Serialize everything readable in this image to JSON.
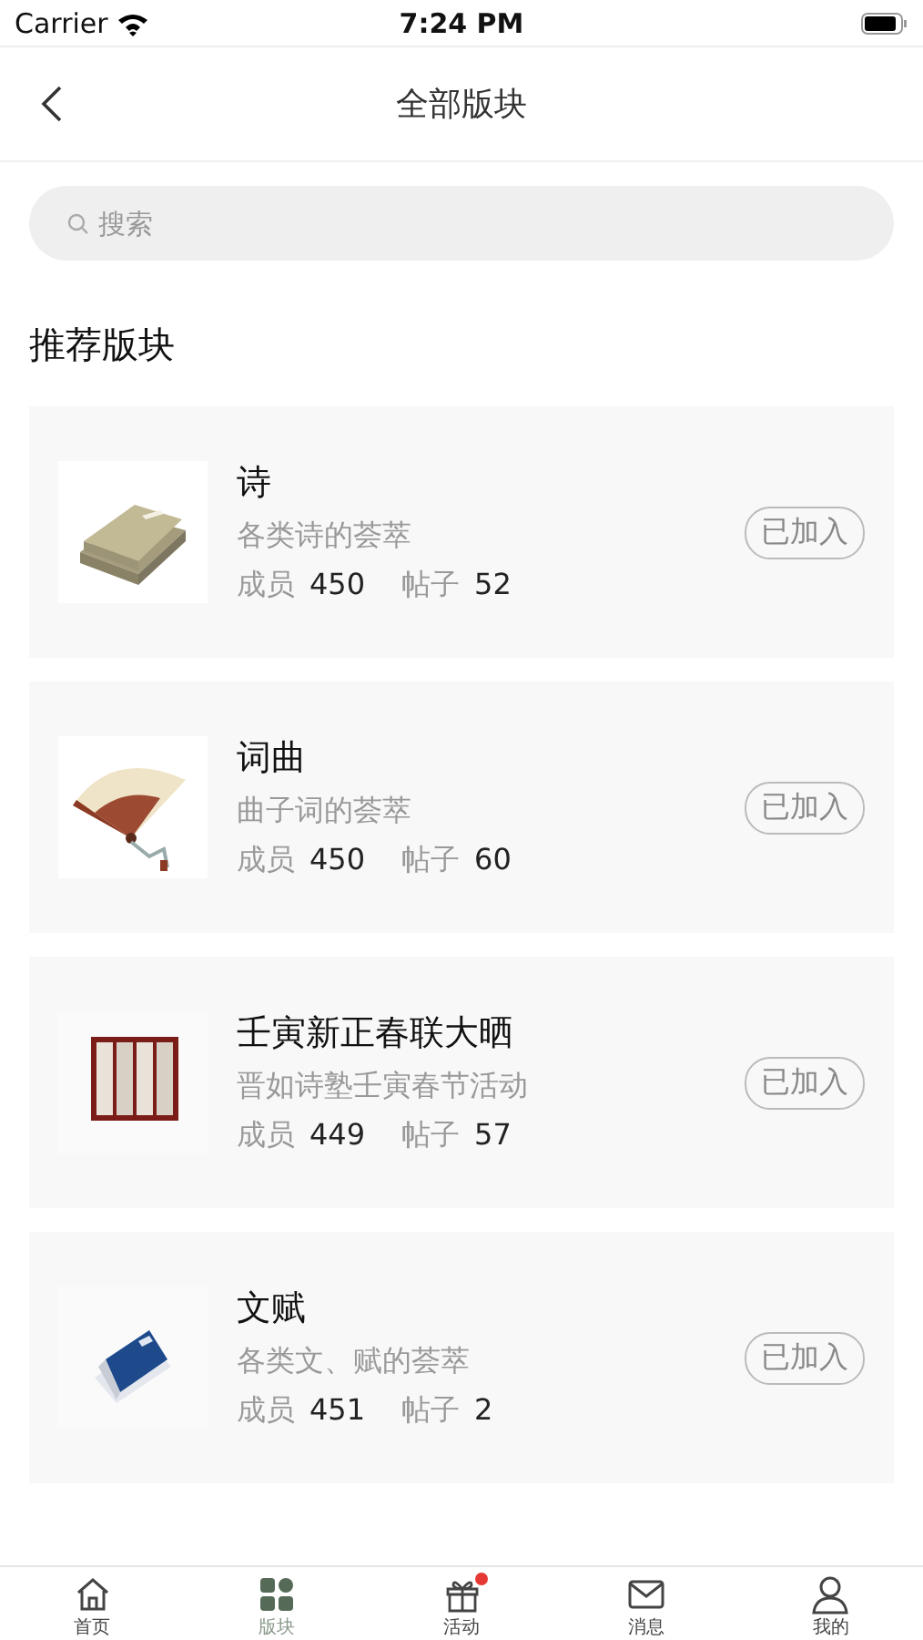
{
  "status_bar": {
    "carrier": "Carrier",
    "time": "7:24 PM"
  },
  "nav": {
    "title": "全部版块"
  },
  "search": {
    "placeholder": "搜索"
  },
  "sections": [
    {
      "title": "推荐版块",
      "boards": [
        {
          "kind": "picture",
          "name": "诗",
          "desc": "各类诗的荟萃",
          "members_label": "成员",
          "members": "450",
          "posts_label": "帖子",
          "posts": "52",
          "button": "已加入"
        },
        {
          "kind": "picture",
          "name": "词曲",
          "desc": "曲子词的荟萃",
          "members_label": "成员",
          "members": "450",
          "posts_label": "帖子",
          "posts": "60",
          "button": "已加入"
        },
        {
          "kind": "picture",
          "name": "壬寅新正春联大晒",
          "desc": "晋如诗塾壬寅春节活动",
          "members_label": "成员",
          "members": "449",
          "posts_label": "帖子",
          "posts": "57",
          "button": "已加入"
        },
        {
          "kind": "picture",
          "name": "文赋",
          "desc": "各类文、赋的荟萃",
          "members_label": "成员",
          "members": "451",
          "posts_label": "帖子",
          "posts": "2",
          "button": "已加入"
        }
      ]
    }
  ],
  "tabs": [
    {
      "label": "首页",
      "selected": false,
      "badge": false
    },
    {
      "label": "版块",
      "selected": true,
      "badge": false
    },
    {
      "label": "活动",
      "selected": false,
      "badge": true
    },
    {
      "label": "消息",
      "selected": false,
      "badge": false
    },
    {
      "label": "我的",
      "selected": false,
      "badge": false
    }
  ]
}
